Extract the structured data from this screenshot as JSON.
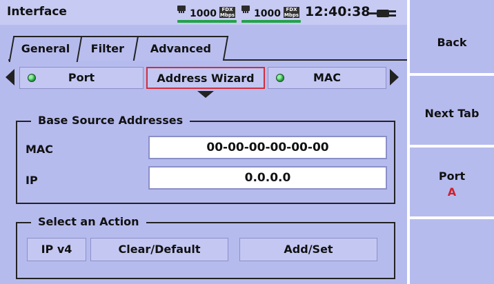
{
  "header": {
    "title": "Interface",
    "links": [
      {
        "speed": "1000",
        "duplex": "FDX",
        "unit": "Mbps"
      },
      {
        "speed": "1000",
        "duplex": "FDX",
        "unit": "Mbps"
      }
    ],
    "time": "12:40:38"
  },
  "tabs": [
    {
      "label": "General",
      "active": true
    },
    {
      "label": "Filter",
      "active": false
    },
    {
      "label": "Advanced",
      "active": false
    }
  ],
  "carousel": {
    "left": "Port",
    "center": "Address Wizard",
    "right": "MAC"
  },
  "source": {
    "title": "Base Source Addresses",
    "mac_label": "MAC",
    "mac_value": "00-00-00-00-00-00",
    "ip_label": "IP",
    "ip_value": "0.0.0.0"
  },
  "action": {
    "title": "Select an Action",
    "ipv4": "IP v4",
    "clear": "Clear/Default",
    "add": "Add/Set"
  },
  "softkeys": {
    "back": "Back",
    "next_tab": "Next Tab",
    "port": "Port",
    "port_value": "A"
  },
  "colors": {
    "panel": "#b6bbee",
    "highlight": "#d12d3c",
    "link_led": "#22a24a",
    "port_value": "#d11f2b"
  }
}
